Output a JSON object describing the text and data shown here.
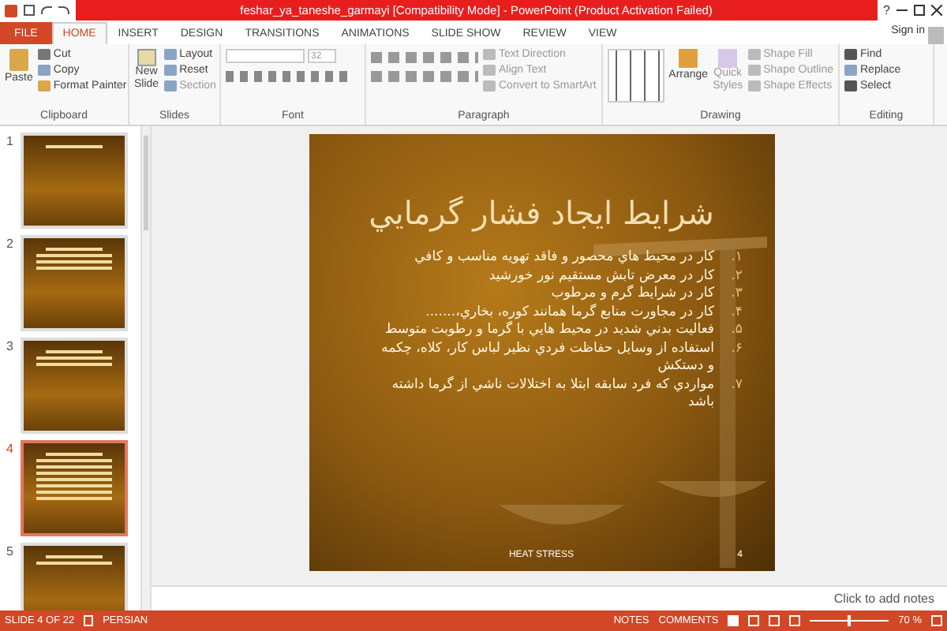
{
  "window": {
    "title": "feshar_ya_taneshe_garmayi [Compatibility Mode] - PowerPoint (Product Activation Failed)",
    "help": "?"
  },
  "tabs": [
    {
      "label": "FILE",
      "kind": "file",
      "selected": false
    },
    {
      "label": "HOME",
      "kind": "tab",
      "selected": true
    },
    {
      "label": "INSERT",
      "kind": "tab",
      "selected": false
    },
    {
      "label": "DESIGN",
      "kind": "tab",
      "selected": false
    },
    {
      "label": "TRANSITIONS",
      "kind": "tab",
      "selected": false
    },
    {
      "label": "ANIMATIONS",
      "kind": "tab",
      "selected": false
    },
    {
      "label": "SLIDE SHOW",
      "kind": "tab",
      "selected": false
    },
    {
      "label": "REVIEW",
      "kind": "tab",
      "selected": false
    },
    {
      "label": "VIEW",
      "kind": "tab",
      "selected": false
    }
  ],
  "sign_in": "Sign in",
  "ribbon": {
    "clipboard": {
      "label": "Clipboard",
      "paste": "Paste",
      "cut": "Cut",
      "copy": "Copy",
      "format_painter": "Format Painter"
    },
    "slides": {
      "label": "Slides",
      "new_slide": "New Slide",
      "layout": "Layout",
      "reset": "Reset",
      "section": "Section"
    },
    "font": {
      "label": "Font",
      "size": "32"
    },
    "paragraph": {
      "label": "Paragraph",
      "text_direction": "Text Direction",
      "align_text": "Align Text",
      "convert": "Convert to SmartArt"
    },
    "drawing": {
      "label": "Drawing",
      "arrange": "Arrange",
      "quick_styles": "Quick Styles",
      "shape_fill": "Shape Fill",
      "shape_outline": "Shape Outline",
      "shape_effects": "Shape Effects"
    },
    "editing": {
      "label": "Editing",
      "find": "Find",
      "replace": "Replace",
      "select": "Select"
    }
  },
  "thumbnails": [
    {
      "number": "1",
      "selected": false
    },
    {
      "number": "2",
      "selected": false
    },
    {
      "number": "3",
      "selected": false
    },
    {
      "number": "4",
      "selected": true
    },
    {
      "number": "5",
      "selected": false
    }
  ],
  "slide": {
    "title": "شرايط ايجاد فشار گرمايي",
    "bullets": [
      {
        "number": "۱.",
        "text": "كار در محيط هاي محصور و فاقد تهويه مناسب و كافي"
      },
      {
        "number": "۲.",
        "text": "كار در معرض تابش مستقيم نور خورشيد"
      },
      {
        "number": "۳.",
        "text": "كار در شرايط گرم و مرطوب"
      },
      {
        "number": "۴.",
        "text": "كار در مجاورت منابع گرما همانند كوره، بخاري،......."
      },
      {
        "number": "۵.",
        "text": "فعاليت بدني شديد در محيط هايي با گرما و رطوبت متوسط"
      },
      {
        "number": "۶.",
        "text": "استفاده از وسايل حفاظت فردي نظير لباس كار، كلاه، چكمه و دستكش"
      },
      {
        "number": "۷.",
        "text": "مواردي كه فرد سابقه ابتلا به اختلالات ناشي از گرما داشته باشد"
      }
    ],
    "footer": "HEAT STRESS",
    "page": "4"
  },
  "notes_placeholder": "Click to add notes",
  "status_bar": {
    "slide": "SLIDE 4 OF 22",
    "language": "PERSIAN",
    "notes": "NOTES",
    "comments": "COMMENTS",
    "zoom": "70 %",
    "level": 0.5
  }
}
